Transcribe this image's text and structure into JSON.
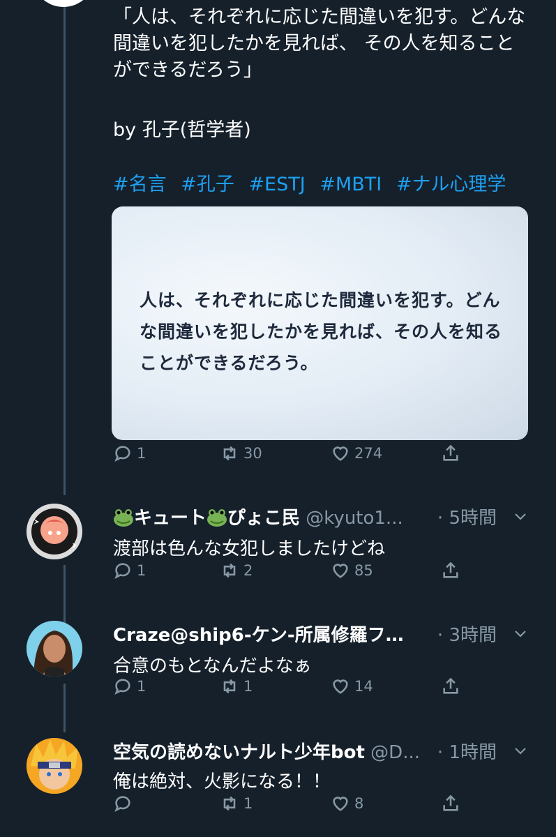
{
  "main_tweet": {
    "text": "「人は、それぞれに応じた間違いを犯す。どんな間違いを犯したかを見れば、 その人を知ることができるだろう」",
    "byline": "by 孔子(哲学者)",
    "hashtags": [
      "#名言",
      "#孔子",
      "#ESTJ",
      "#MBTI",
      "#ナル心理学"
    ],
    "image_text": "人は、それぞれに応じた間違いを犯す。どんな間違いを犯したかを見れば、その人を知ることができるだろう。",
    "stats": {
      "replies": "1",
      "retweets": "30",
      "likes": "274"
    }
  },
  "replies": [
    {
      "name": "キュート ぴょこ民",
      "name_parts": [
        "キュート",
        "ぴょこ民"
      ],
      "handle": "@kyuto1...",
      "time": "· 5時間",
      "text": "渡部は色んな女犯しましたけどね",
      "stats": {
        "replies": "1",
        "retweets": "2",
        "likes": "85"
      }
    },
    {
      "name": "Craze@ship6-ケン-所属修羅フ…",
      "handle": "",
      "time": "· 3時間",
      "text": "合意のもとなんだよなぁ",
      "stats": {
        "replies": "1",
        "retweets": "1",
        "likes": "14"
      }
    },
    {
      "name": "空気の読めないナルト少年bot",
      "handle": "@D...",
      "time": "· 1時間",
      "text": "俺は絶対、火影になる！！",
      "stats": {
        "replies": "",
        "retweets": "1",
        "likes": "8"
      }
    }
  ],
  "colors": {
    "background": "#15202b",
    "hashtag": "#1da1f2",
    "muted": "#8899a6",
    "thread_line": "#3d5466"
  },
  "icons": [
    "reply-icon",
    "retweet-icon",
    "like-icon",
    "share-icon",
    "chevron-down-icon",
    "frog-emoji-icon"
  ]
}
